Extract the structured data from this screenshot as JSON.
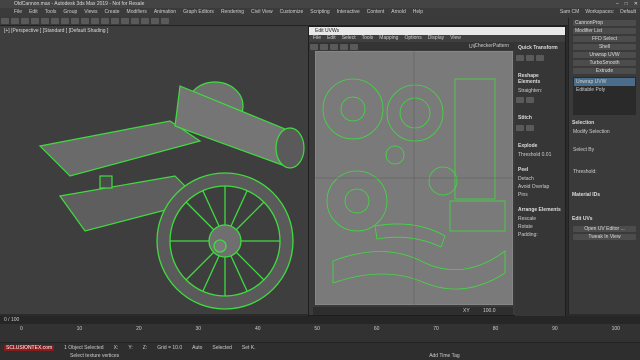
{
  "titlebar": {
    "text": "OldCannon.max - Autodesk 3ds Max 2019 - Not for Resale",
    "controls": [
      "–",
      "□",
      "✕"
    ]
  },
  "menubar": {
    "items": [
      "File",
      "Edit",
      "Tools",
      "Group",
      "Views",
      "Create",
      "Modifiers",
      "Animation",
      "Graph Editors",
      "Rendering",
      "Civil View",
      "Customize",
      "Scripting",
      "Interactive",
      "Content",
      "Arnold",
      "Help"
    ]
  },
  "user": {
    "name": "Sam CM",
    "workspace_label": "Workspaces:",
    "workspace": "Default"
  },
  "viewport": {
    "label": "[+] [Perspective ] [Standard ] [Default Shading ]"
  },
  "uv_editor": {
    "title": "Edit UVWs",
    "menu": [
      "File",
      "Edit",
      "Select",
      "Tools",
      "Mapping",
      "Options",
      "Display",
      "View"
    ],
    "texture_dropdown": "CheckerPattern",
    "uv_label": "UV",
    "sections": {
      "quick": "Quick Transform",
      "reshape": "Reshape Elements",
      "stitch": "Stitch",
      "explode": "Explode",
      "peel": "Peel",
      "arrange": "Arrange Elements"
    },
    "straighten": "Straighten:",
    "threshold": "Threshold",
    "threshold_value": "0.01",
    "detach": "Detach",
    "avoid_overlap": "Avoid Overlap",
    "pins": "Pins",
    "rescale": "Rescale",
    "rotate": "Rotate",
    "padding": "Padding:",
    "bottom_zoom": "100.0",
    "xy": "XY"
  },
  "command_panel": {
    "object_name": "CannonProp",
    "modifier_list": "Modifier List",
    "buttons": [
      "FFD Select",
      "Shell",
      "Unwrap UVW",
      "TurboSmooth",
      "Extrude"
    ],
    "modifier_stack": [
      "Unwrap UVW",
      "Editable Poly"
    ],
    "selection": "Selection",
    "modify_selection": "Modify Selection",
    "select_by": "Select By",
    "threshold": "Threshold:",
    "material_ids": "Material IDs",
    "edit_uvs": "Edit UVs",
    "open_uv_editor": "Open UV Editor ...",
    "tweak_in_view": "Tweak In View"
  },
  "timeline": {
    "frame": "0 / 100",
    "ticks": [
      "0",
      "10",
      "20",
      "30",
      "40",
      "50",
      "60",
      "70",
      "80",
      "90",
      "100"
    ]
  },
  "status": {
    "selected": "1 Object Selected",
    "prompt": "Select texture vertices",
    "watermark": "SCLUSIONTEX.com",
    "x": "X:",
    "y": "Y:",
    "z": "Z:",
    "grid": "Grid = 10.0",
    "add_time_tag": "Add Time Tag",
    "auto": "Auto",
    "selected_dd": "Selected",
    "set_key": "Set K."
  },
  "colors": {
    "wire": "#3fdc3f",
    "bg": "#2b2b2b",
    "uv_bg": "#7a7a7a"
  }
}
